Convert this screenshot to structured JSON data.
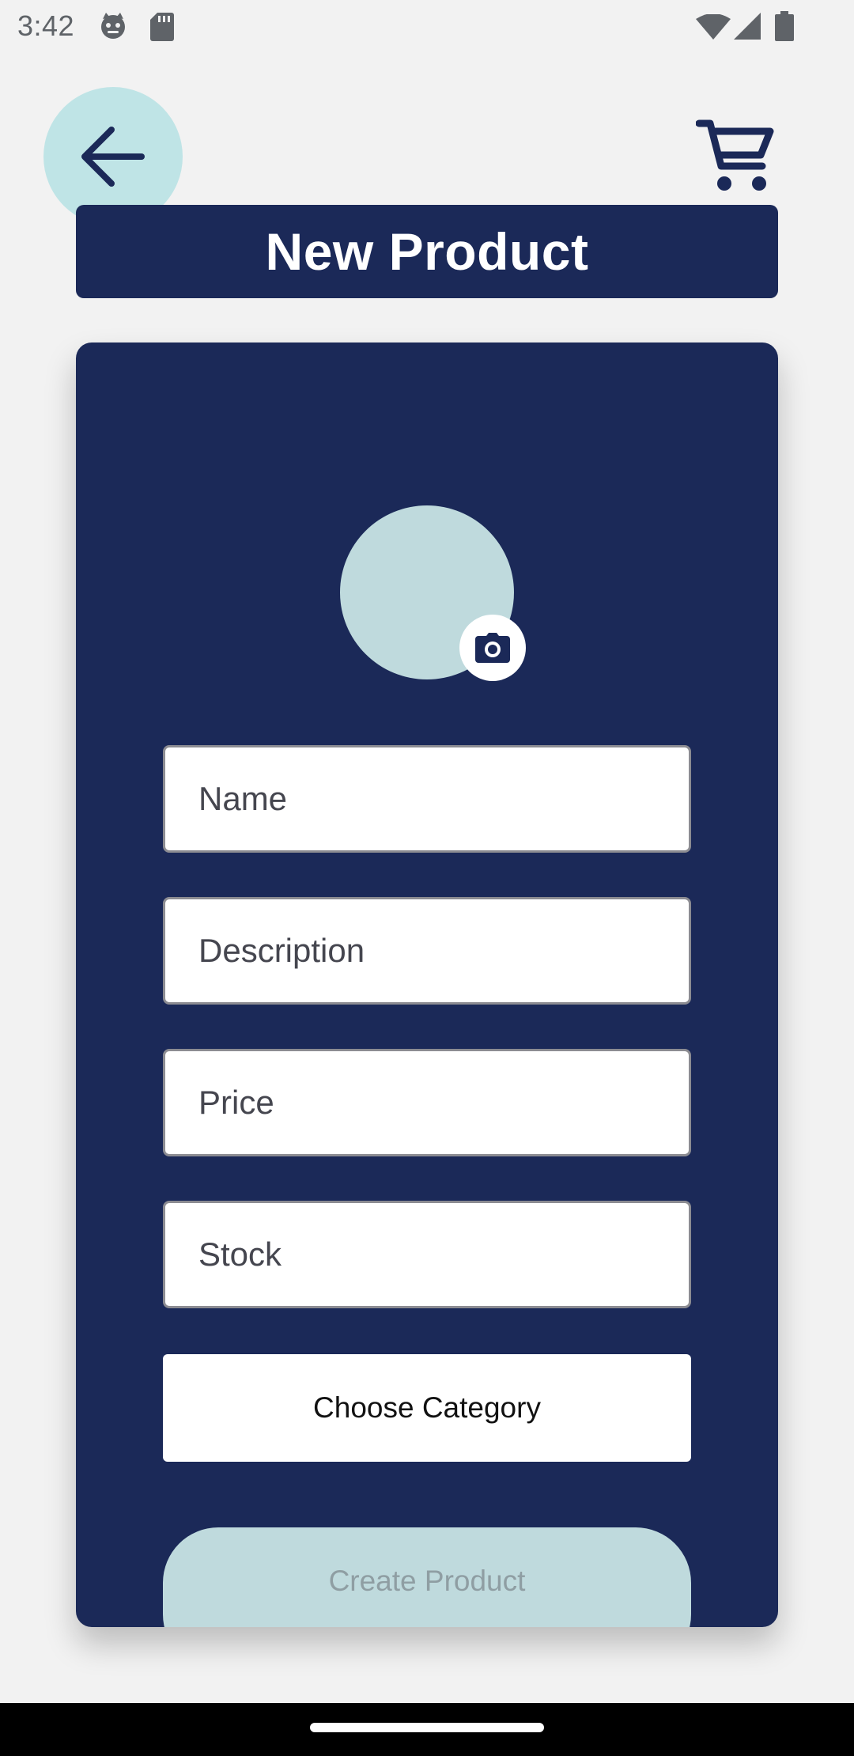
{
  "status_bar": {
    "time": "3:42",
    "icons": [
      "cat-notification-icon",
      "sd-card-icon",
      "wifi-icon",
      "cellular-signal-icon",
      "battery-icon"
    ]
  },
  "header": {
    "back_icon": "arrow-back-icon",
    "cart_icon": "shopping-cart-icon",
    "title": "New Product"
  },
  "form": {
    "image_picker_icon": "camera-icon",
    "fields": {
      "name": {
        "placeholder": "Name",
        "value": ""
      },
      "description": {
        "placeholder": "Description",
        "value": ""
      },
      "price": {
        "placeholder": "Price",
        "value": ""
      },
      "stock": {
        "placeholder": "Stock",
        "value": ""
      }
    },
    "category_label": "Choose Category",
    "submit_label": "Create Product"
  },
  "colors": {
    "background": "#f2f2f2",
    "primary_navy": "#1b2958",
    "accent_teal": "#bfe4e6",
    "avatar_placeholder": "#bfdadd",
    "submit_text": "#8f9ea3"
  }
}
